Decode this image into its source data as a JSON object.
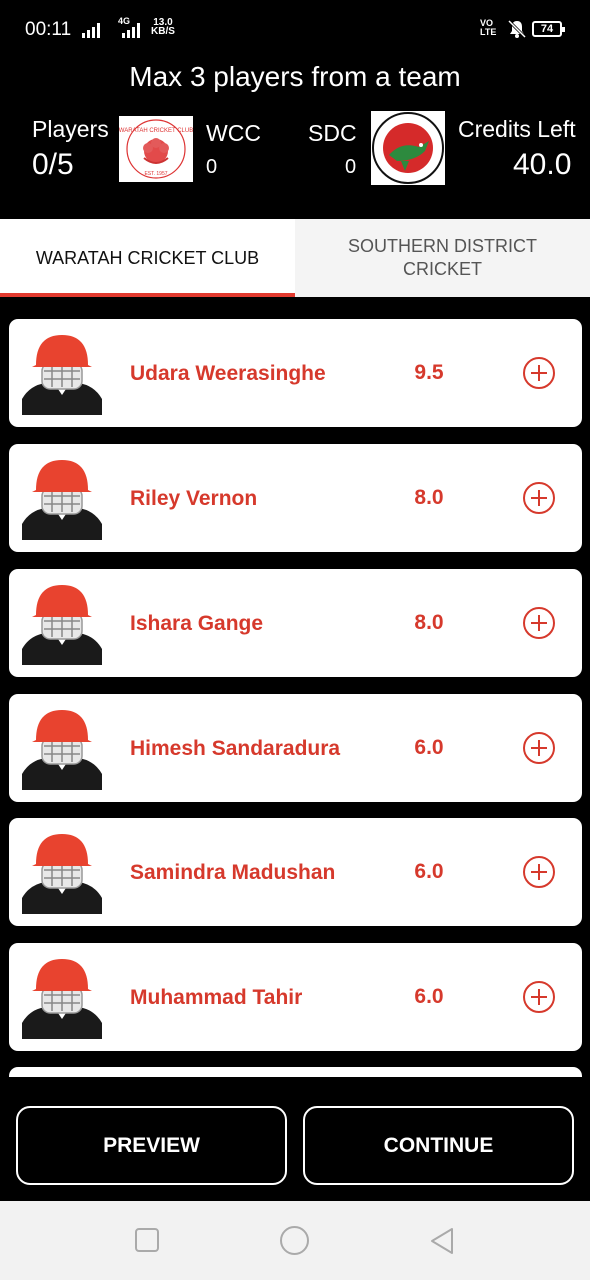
{
  "status_bar": {
    "time": "00:11",
    "network_label": "4G",
    "speed_value": "13.0",
    "speed_unit": "KB/S",
    "volte_top": "VO",
    "volte_bottom": "LTE",
    "battery": "74",
    "icons": [
      "signal-icon",
      "signal-icon",
      "mute-bell-icon",
      "battery-icon"
    ]
  },
  "header": {
    "rule": "Max 3 players from a team",
    "players_label": "Players",
    "players_count": "0/5",
    "team1_abbr": "WCC",
    "team1_count": "0",
    "team2_abbr": "SDC",
    "team2_count": "0",
    "credits_label": "Credits Left",
    "credits_value": "40.0"
  },
  "tabs": [
    {
      "label": "WARATAH CRICKET CLUB",
      "active": true
    },
    {
      "label": "SOUTHERN DISTRICT CRICKET",
      "active": false
    }
  ],
  "players": [
    {
      "name": "Udara Weerasinghe",
      "credits": "9.5"
    },
    {
      "name": "Riley Vernon",
      "credits": "8.0"
    },
    {
      "name": "Ishara Gange",
      "credits": "8.0"
    },
    {
      "name": "Himesh Sandaradura",
      "credits": "6.0"
    },
    {
      "name": "Samindra Madushan",
      "credits": "6.0"
    },
    {
      "name": "Muhammad Tahir",
      "credits": "6.0"
    }
  ],
  "buttons": {
    "preview": "PREVIEW",
    "continue": "CONTINUE"
  },
  "colors": {
    "accent": "#d6392c",
    "tab_indicator": "#e23a2f",
    "helmet": "#e8432f"
  }
}
